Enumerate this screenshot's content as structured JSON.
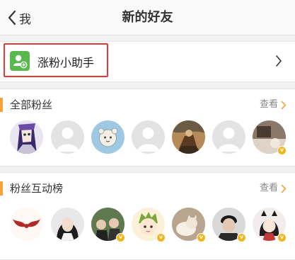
{
  "navbar": {
    "back_label": "我",
    "title": "新的好友"
  },
  "helper": {
    "label": "涨粉小助手"
  },
  "fans": {
    "title": "全部粉丝",
    "see_all": "查看",
    "avatars": [
      {
        "name": "anime-figure",
        "verified": false
      },
      {
        "name": "default",
        "verified": false
      },
      {
        "name": "cartoon-bear",
        "verified": false
      },
      {
        "name": "default",
        "verified": false
      },
      {
        "name": "painting",
        "verified": false
      },
      {
        "name": "default",
        "verified": false
      },
      {
        "name": "photo",
        "verified": true
      }
    ]
  },
  "rank": {
    "title": "粉丝互动榜",
    "see_all": "查看",
    "avatars": [
      {
        "name": "wings-logo",
        "verified": false
      },
      {
        "name": "girl-portrait",
        "verified": false
      },
      {
        "name": "group-photo",
        "verified": true
      },
      {
        "name": "cartoon-boy",
        "verified": true
      },
      {
        "name": "cat-photo",
        "verified": true
      },
      {
        "name": "man-portrait",
        "verified": true
      },
      {
        "name": "anime-girl",
        "verified": true
      }
    ]
  },
  "colors": {
    "accent": "#f7a33a",
    "highlight_box": "#e53935",
    "helper_icon": "#59b94f",
    "verified_badge": "#f2b51e"
  },
  "badge_glyph": "v"
}
